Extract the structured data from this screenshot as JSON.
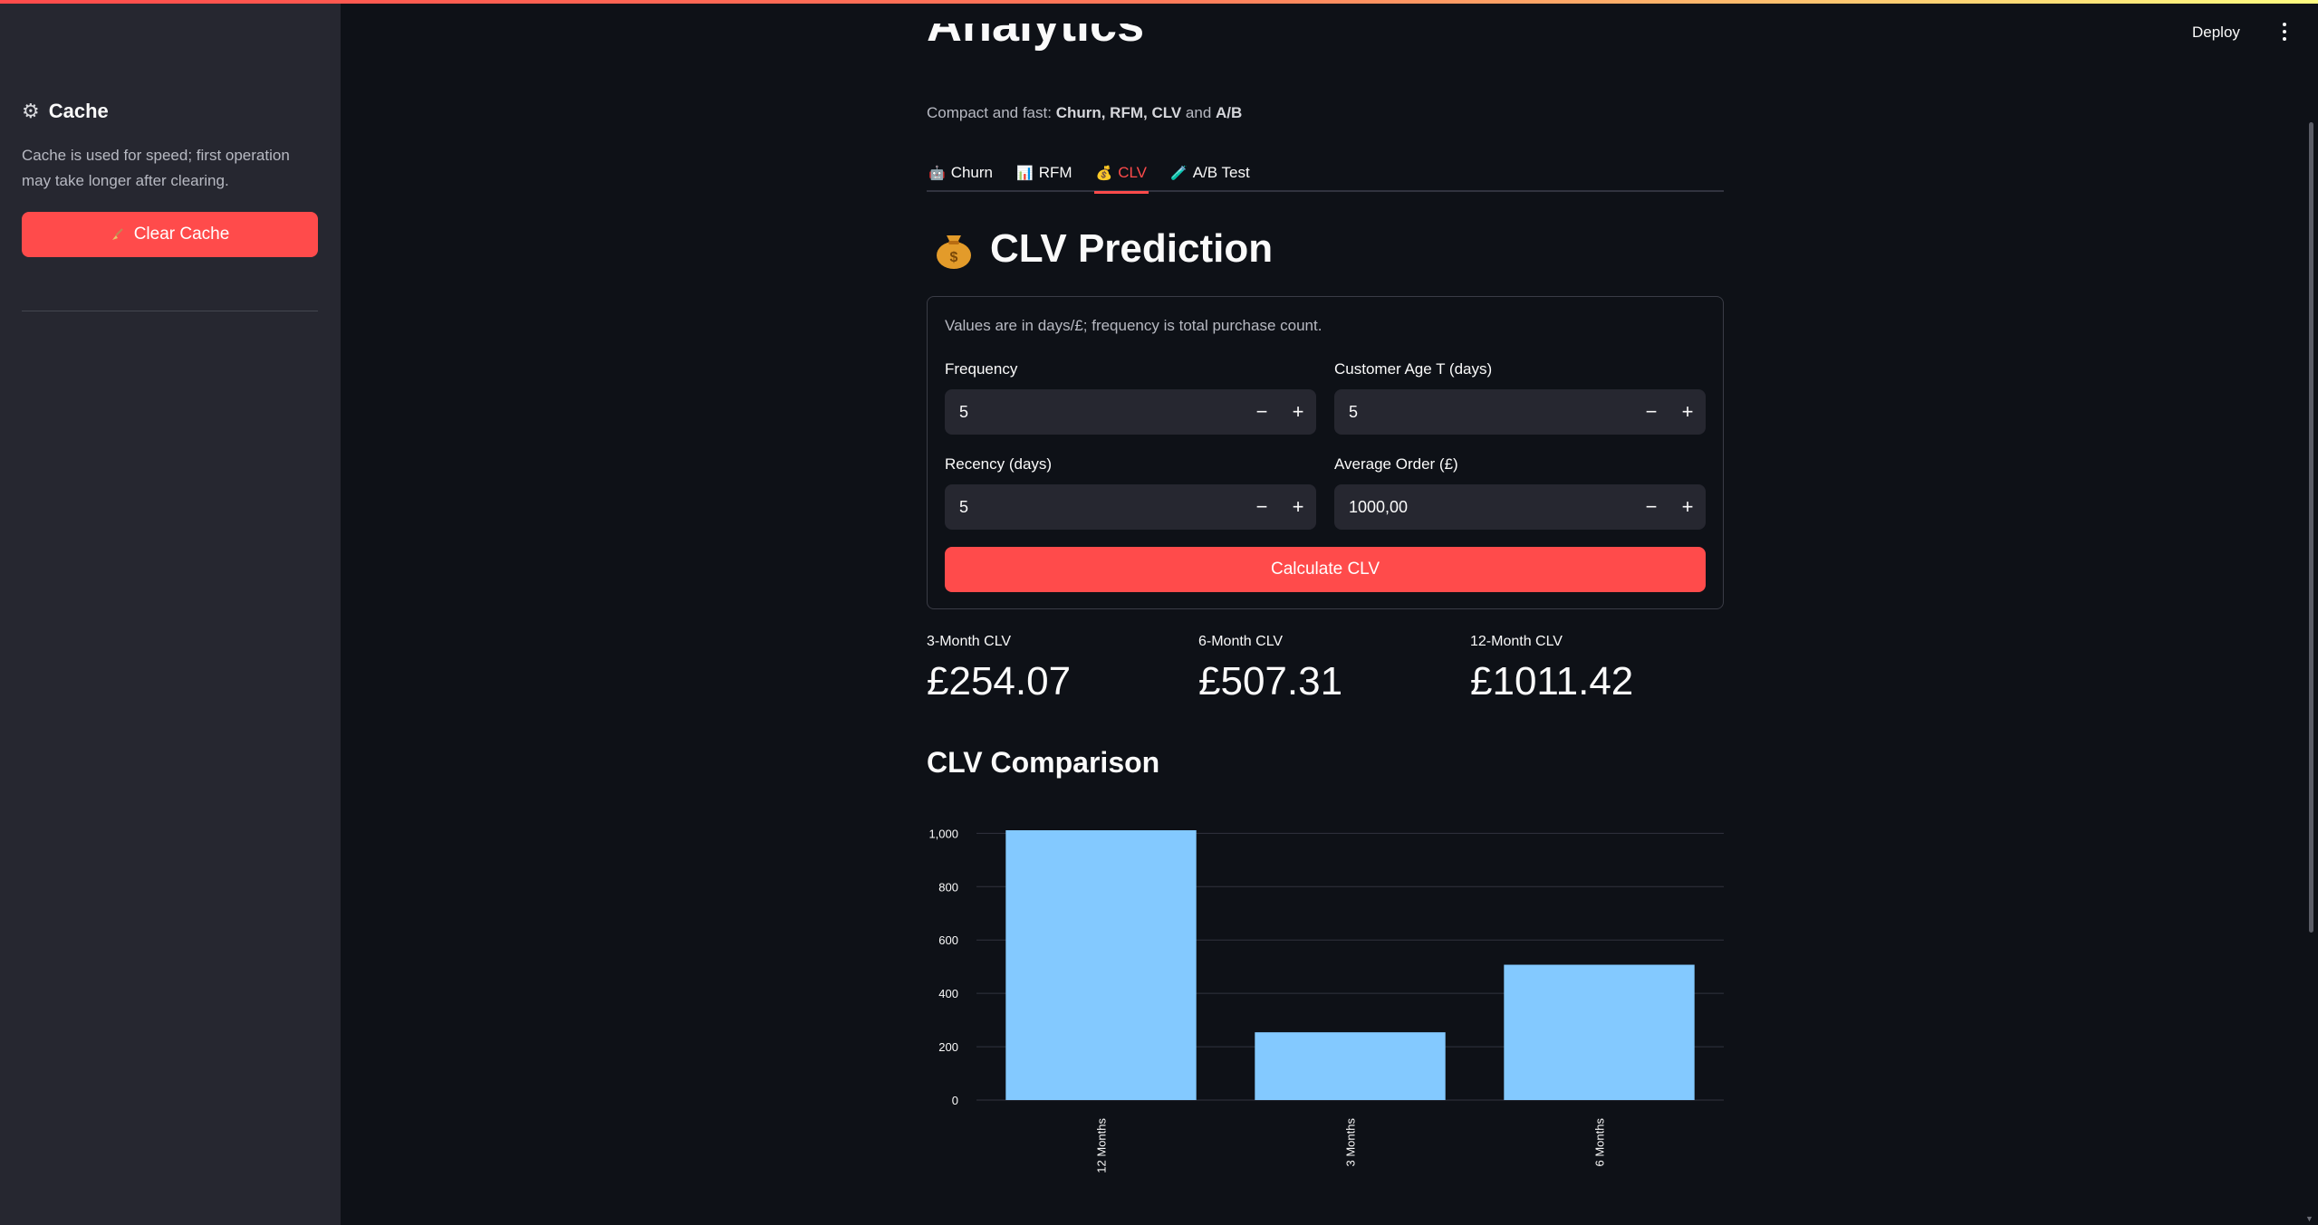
{
  "sidebar": {
    "cache_heading": "Cache",
    "cache_icon": "gear-icon",
    "cache_description": "Cache is used for speed; first operation may take longer after clearing.",
    "clear_button_label": "Clear Cache",
    "clear_button_icon": "broom-icon"
  },
  "header": {
    "deploy_label": "Deploy",
    "menu_icon": "kebab-menu-icon"
  },
  "main": {
    "page_title_partial": "Analytics",
    "subtitle_prefix": "Compact and fast: ",
    "subtitle_bold": "Churn, RFM, CLV",
    "subtitle_and": " and ",
    "subtitle_bold2": "A/B",
    "tabs": [
      {
        "label": "Churn",
        "icon": "robot-icon",
        "icon_char": "🤖",
        "active": false
      },
      {
        "label": "RFM",
        "icon": "bar-chart-icon",
        "icon_char": "📊",
        "active": false
      },
      {
        "label": "CLV",
        "icon": "money-bag-icon",
        "icon_char": "💰",
        "active": true
      },
      {
        "label": "A/B Test",
        "icon": "test-tube-icon",
        "icon_char": "🧪",
        "active": false
      }
    ],
    "section_title": "CLV Prediction",
    "section_icon": "money-bag-icon",
    "form": {
      "note": "Values are in days/£; frequency is total purchase count.",
      "frequency_label": "Frequency",
      "frequency_value": "5",
      "customer_age_label": "Customer Age T (days)",
      "customer_age_value": "5",
      "recency_label": "Recency (days)",
      "recency_value": "5",
      "avg_order_label": "Average Order (£)",
      "avg_order_value": "1000,00",
      "minus": "−",
      "plus": "+",
      "calculate_label": "Calculate CLV"
    },
    "metrics": [
      {
        "label": "3-Month CLV",
        "value": "£254.07"
      },
      {
        "label": "6-Month CLV",
        "value": "£507.31"
      },
      {
        "label": "12-Month CLV",
        "value": "£1011.42"
      }
    ],
    "chart_title": "CLV Comparison"
  },
  "colors": {
    "accent": "#ff4b4b",
    "bar": "#83c9ff",
    "background": "#0e1117",
    "sidebar": "#262730"
  },
  "chart_data": {
    "type": "bar",
    "categories": [
      "12 Months",
      "3 Months",
      "6 Months"
    ],
    "values": [
      1011.42,
      254.07,
      507.31
    ],
    "title": "CLV Comparison",
    "xlabel": "",
    "ylabel": "",
    "ylim": [
      0,
      1011.42
    ],
    "yticks": [
      0,
      200,
      400,
      600,
      800,
      1000
    ],
    "ytick_labels": [
      "0",
      "200",
      "400",
      "600",
      "800",
      "1,000"
    ],
    "grid": true
  }
}
